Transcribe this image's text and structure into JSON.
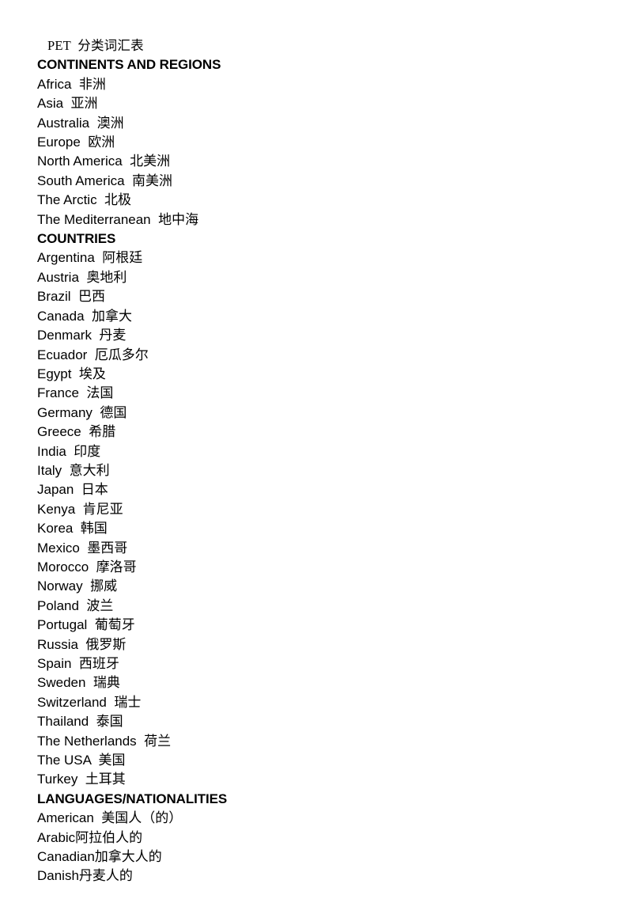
{
  "document": {
    "title": "PET  分类词汇表"
  },
  "sections": [
    {
      "heading": "CONTINENTS AND REGIONS",
      "entries": [
        "Africa  非洲",
        "Asia  亚洲",
        "Australia  澳洲",
        "Europe  欧洲",
        "North America  北美洲",
        "South America  南美洲",
        "The Arctic  北极",
        "The Mediterranean  地中海"
      ]
    },
    {
      "heading": "COUNTRIES",
      "entries": [
        "Argentina  阿根廷",
        "Austria  奥地利",
        "Brazil  巴西",
        "Canada  加拿大",
        "Denmark  丹麦",
        "Ecuador  厄瓜多尔",
        "Egypt  埃及",
        "France  法国",
        "Germany  德国",
        "Greece  希腊",
        "India  印度",
        "Italy  意大利",
        "Japan  日本",
        "Kenya  肯尼亚",
        "Korea  韩国",
        "Mexico  墨西哥",
        "Morocco  摩洛哥",
        "Norway  挪威",
        "Poland  波兰",
        "Portugal  葡萄牙",
        "Russia  俄罗斯",
        "Spain  西班牙",
        "Sweden  瑞典",
        "Switzerland  瑞士",
        "Thailand  泰国",
        "The Netherlands  荷兰",
        "The USA  美国",
        "Turkey  土耳其"
      ]
    },
    {
      "heading": "LANGUAGES/NATIONALITIES",
      "entries": [
        "American  美国人（的）",
        "Arabic阿拉伯人的",
        "Canadian加拿大人的",
        "Danish丹麦人的"
      ]
    }
  ]
}
